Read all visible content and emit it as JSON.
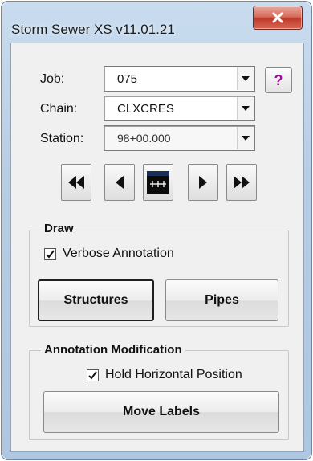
{
  "window": {
    "title": "Storm Sewer XS v11.01.21"
  },
  "fields": {
    "job": {
      "label": "Job:",
      "value": "075"
    },
    "chain": {
      "label": "Chain:",
      "value": "CLXCRES"
    },
    "station": {
      "label": "Station:",
      "value": "98+00.000"
    }
  },
  "help_button": {
    "label": "?"
  },
  "draw_group": {
    "title": "Draw",
    "verbose_annotation": {
      "label": "Verbose Annotation",
      "checked": true
    },
    "structures_label": "Structures",
    "pipes_label": "Pipes"
  },
  "annotation_group": {
    "title": "Annotation Modification",
    "hold_horizontal": {
      "label": "Hold Horizontal Position",
      "checked": true
    },
    "move_labels_label": "Move Labels"
  },
  "nav_icons": [
    "first-icon",
    "previous-icon",
    "select-station-icon",
    "next-icon",
    "last-icon"
  ]
}
